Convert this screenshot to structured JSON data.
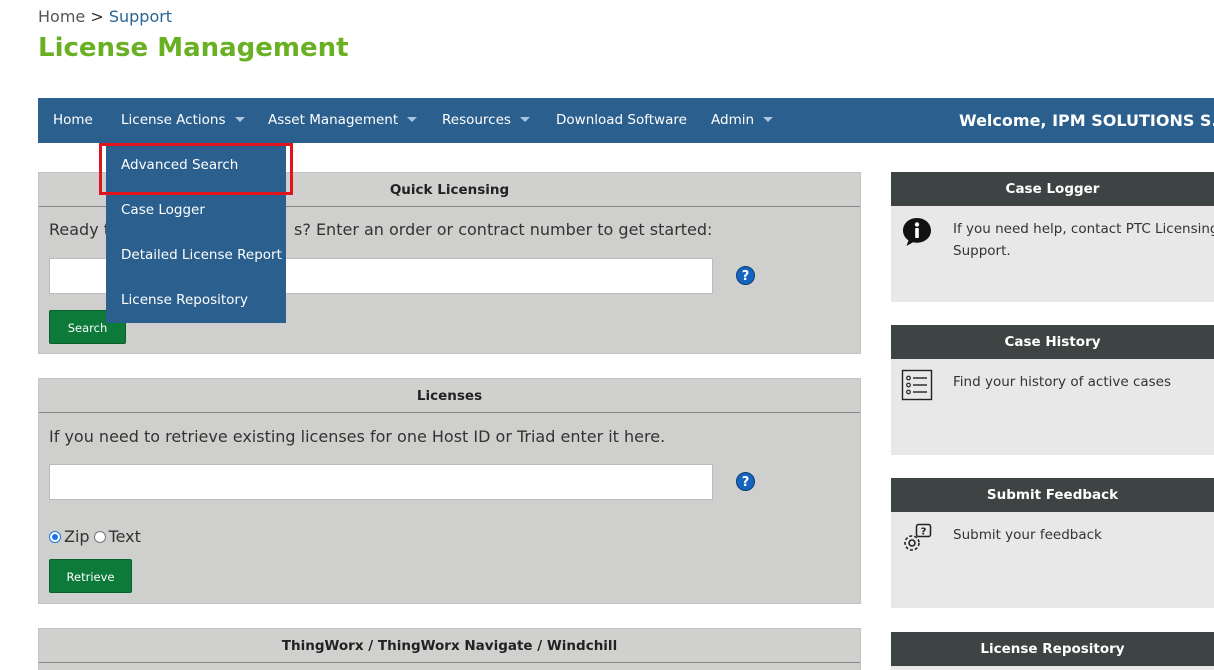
{
  "breadcrumb": {
    "home": "Home",
    "separator": " > ",
    "current": "Support"
  },
  "page_title": "License Management",
  "nav": {
    "items": [
      {
        "label": "Home"
      },
      {
        "label": "License Actions"
      },
      {
        "label": "Asset Management"
      },
      {
        "label": "Resources"
      },
      {
        "label": "Download Software"
      },
      {
        "label": "Admin"
      }
    ],
    "welcome": "Welcome, IPM SOLUTIONS S.R.O. ("
  },
  "dropdown": {
    "items": [
      {
        "label": "Advanced Search"
      },
      {
        "label": "Case Logger"
      },
      {
        "label": "Detailed License Report"
      },
      {
        "label": "License Repository"
      }
    ]
  },
  "quick_licensing": {
    "title": "Quick Licensing",
    "prompt_start": "Ready t",
    "prompt_end": "s? Enter an order or contract number to get started:",
    "input_value": "",
    "help_icon": "?",
    "button": "Search"
  },
  "licenses": {
    "title": "Licenses",
    "prompt": "If you need to retrieve existing licenses for one Host ID or Triad enter it here.",
    "input_value": "",
    "help_icon": "?",
    "radio_zip": "Zip",
    "radio_text": "Text",
    "selected_format": "Zip",
    "button": "Retrieve"
  },
  "thingworx": {
    "title": "ThingWorx / ThingWorx Navigate / Windchill"
  },
  "sidebar": {
    "case_logger": {
      "title": "Case Logger",
      "text": "If you need help, contact PTC Licensing Support.",
      "icon": "info-icon"
    },
    "case_history": {
      "title": "Case History",
      "text": "Find your history of active cases",
      "icon": "list-icon"
    },
    "submit_feedback": {
      "title": "Submit Feedback",
      "text": "Submit your feedback",
      "icon": "gear-question-icon"
    },
    "license_repository": {
      "title": "License Repository"
    }
  },
  "colors": {
    "nav_bg": "#2b5f8e",
    "title_green": "#6ab023",
    "button_green": "#0d7a3a",
    "side_header": "#3d4443",
    "highlight": "#e0141e"
  }
}
